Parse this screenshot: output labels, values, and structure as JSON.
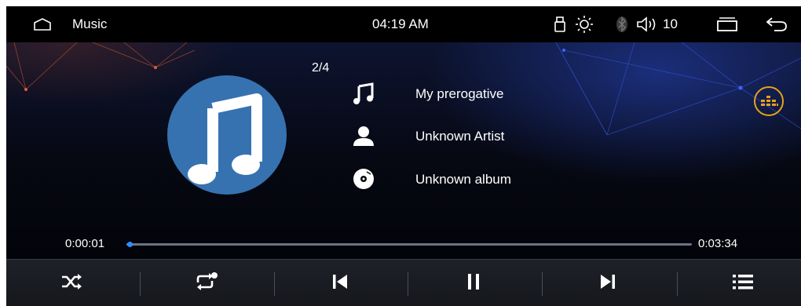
{
  "status_bar": {
    "app_title": "Music",
    "clock": "04:19 AM",
    "volume_level": "10",
    "icons": [
      "home-icon",
      "usb-icon",
      "brightness-icon",
      "bluetooth-icon",
      "volume-icon",
      "recent-apps-icon",
      "back-icon"
    ]
  },
  "player": {
    "track_index": "2/4",
    "song_title": "My prerogative",
    "artist": "Unknown Artist",
    "album": "Unknown album",
    "elapsed": "0:00:01",
    "total": "0:03:34",
    "progress": 0.005
  },
  "controls": [
    "shuffle-icon",
    "repeat-one-icon",
    "previous-icon",
    "pause-icon",
    "next-icon",
    "playlist-icon"
  ],
  "colors": {
    "accent": "#2f8cff",
    "album_art": "#3672b0",
    "equalizer": "#e6a21a"
  }
}
